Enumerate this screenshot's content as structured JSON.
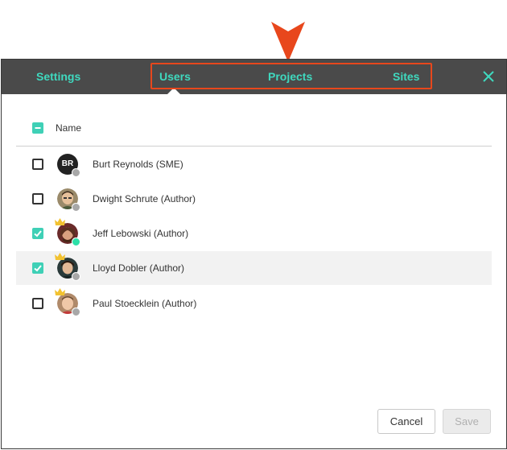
{
  "tabs": [
    {
      "label": "Settings"
    },
    {
      "label": "Users"
    },
    {
      "label": "Projects"
    },
    {
      "label": "Sites"
    }
  ],
  "active_tab": "Users",
  "table": {
    "header": {
      "name_label": "Name",
      "select_all_state": "partial"
    },
    "rows": [
      {
        "name": "Burt Reynolds (SME)",
        "initials": "BR",
        "checked": false,
        "status": "offline",
        "crown": false,
        "avatar": "initials"
      },
      {
        "name": "Dwight Schrute (Author)",
        "checked": false,
        "status": "offline",
        "crown": false,
        "avatar": "photo"
      },
      {
        "name": "Jeff Lebowski (Author)",
        "checked": true,
        "status": "online",
        "crown": true,
        "avatar": "photo"
      },
      {
        "name": "Lloyd Dobler (Author)",
        "checked": true,
        "status": "offline",
        "crown": true,
        "avatar": "photo"
      },
      {
        "name": "Paul Stoecklein (Author)",
        "checked": false,
        "status": "offline",
        "crown": true,
        "avatar": "photo"
      }
    ]
  },
  "buttons": {
    "cancel_label": "Cancel",
    "save_label": "Save"
  },
  "colors": {
    "accent": "#3fd9bf",
    "tabbar_bg": "#4a4a4a",
    "highlight": "#e8471c",
    "online": "#2de0a8",
    "offline": "#a8a8a8"
  },
  "icons": {
    "close": "close-icon",
    "crown": "crown-icon",
    "pointer": "pointer-arrow-icon"
  }
}
